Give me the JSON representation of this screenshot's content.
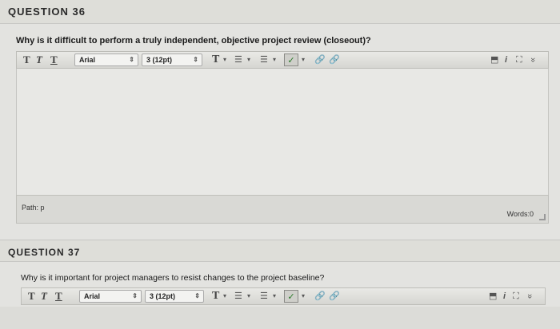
{
  "q36": {
    "header": "QUESTION 36",
    "prompt": "Why is it difficult to perform a truly independent, objective project review (closeout)?",
    "toolbar": {
      "style_t1": "T",
      "style_t2": "T",
      "style_t3": "T",
      "font_family": "Arial",
      "font_size": "3 (12pt)",
      "text_color": "T",
      "list_unordered": "☰",
      "list_ordered": "☰",
      "spellcheck": "✓"
    },
    "status": {
      "path_label": "Path: p",
      "word_count": "Words:0"
    }
  },
  "q37": {
    "header": "QUESTION 37",
    "prompt": "Why is it important for project managers to resist changes to the project baseline?",
    "toolbar": {
      "style_t1": "T",
      "style_t2": "T",
      "style_t3": "T",
      "font_family": "Arial",
      "font_size": "3 (12pt)",
      "text_color": "T",
      "list_unordered": "☰",
      "list_ordered": "☰",
      "spellcheck": "✓"
    }
  },
  "icons": {
    "dropdown_arrow": "▾",
    "select_arrow": "⇕",
    "link": "🔗",
    "preview": "⬒",
    "info": "i",
    "fullscreen": "⛶",
    "collapse": "»"
  }
}
